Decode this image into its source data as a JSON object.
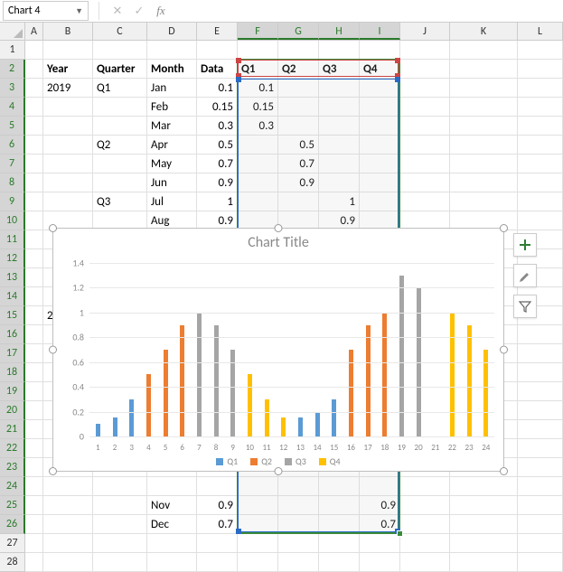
{
  "namebox": "Chart 4",
  "columns": [
    "A",
    "B",
    "C",
    "D",
    "E",
    "F",
    "G",
    "H",
    "I",
    "J",
    "K",
    "L"
  ],
  "col_widths": [
    "wA",
    "wB",
    "wC",
    "wD",
    "wE",
    "wF",
    "wG",
    "wH",
    "wI",
    "wJ",
    "wK",
    "wL"
  ],
  "selected_cols": [
    "F",
    "G",
    "H",
    "I"
  ],
  "row_count": 28,
  "selected_rows_from": 2,
  "selected_rows_to": 26,
  "headers": {
    "B": "Year",
    "C": "Quarter",
    "D": "Month",
    "E": "Data",
    "F": "Q1",
    "G": "Q2",
    "H": "Q3",
    "I": "Q4"
  },
  "table": [
    {
      "B": "2019",
      "C": "Q1",
      "D": "Jan",
      "E": "0.1",
      "F": "0.1"
    },
    {
      "C": "",
      "D": "Feb",
      "E": "0.15",
      "F": "0.15"
    },
    {
      "C": "",
      "D": "Mar",
      "E": "0.3",
      "F": "0.3"
    },
    {
      "C": "Q2",
      "D": "Apr",
      "E": "0.5",
      "G": "0.5"
    },
    {
      "C": "",
      "D": "May",
      "E": "0.7",
      "G": "0.7"
    },
    {
      "C": "",
      "D": "Jun",
      "E": "0.9",
      "G": "0.9"
    },
    {
      "C": "Q3",
      "D": "Jul",
      "E": "1",
      "H": "1"
    },
    {
      "C": "",
      "D": "Aug",
      "E": "0.9",
      "H": "0.9"
    },
    {
      "C": "",
      "D": "",
      "E": ""
    },
    {
      "C": "",
      "D": "",
      "E": ""
    },
    {
      "C": "",
      "D": "",
      "E": ""
    },
    {
      "C": "",
      "D": "",
      "E": ""
    },
    {
      "B": "202",
      "C": "",
      "D": "",
      "E": ""
    },
    {
      "C": "",
      "D": "",
      "E": ""
    },
    {
      "C": "",
      "D": "",
      "E": ""
    },
    {
      "C": "",
      "D": "",
      "E": ""
    },
    {
      "C": "",
      "D": "",
      "E": ""
    },
    {
      "C": "",
      "D": "",
      "E": ""
    },
    {
      "C": "",
      "D": "",
      "E": ""
    },
    {
      "C": "",
      "D": "",
      "E": ""
    },
    {
      "C": "",
      "D": "",
      "E": ""
    },
    {
      "C": "",
      "D": "",
      "E": ""
    },
    {
      "C": "",
      "D": "Nov",
      "E": "0.9",
      "I": "0.9"
    },
    {
      "C": "",
      "D": "Dec",
      "E": "0.7",
      "I": "0.7"
    }
  ],
  "chart_data": {
    "type": "bar",
    "title": "Chart Title",
    "xlabel": "",
    "ylabel": "",
    "ylim": [
      0,
      1.4
    ],
    "yticks": [
      0,
      0.2,
      0.4,
      0.6,
      0.8,
      1,
      1.2,
      1.4
    ],
    "categories": [
      1,
      2,
      3,
      4,
      5,
      6,
      7,
      8,
      9,
      10,
      11,
      12,
      13,
      14,
      15,
      16,
      17,
      18,
      19,
      20,
      21,
      22,
      23,
      24
    ],
    "series": [
      {
        "name": "Q1",
        "color": "#5b9bd5",
        "values": [
          0.1,
          0.15,
          0.3,
          null,
          null,
          null,
          null,
          null,
          null,
          null,
          null,
          null,
          0.15,
          0.2,
          0.3,
          null,
          null,
          null,
          null,
          null,
          null,
          null,
          null,
          null
        ]
      },
      {
        "name": "Q2",
        "color": "#ed7d31",
        "values": [
          null,
          null,
          null,
          0.5,
          0.7,
          0.9,
          null,
          null,
          null,
          null,
          null,
          null,
          null,
          null,
          null,
          0.7,
          0.9,
          1.0,
          null,
          null,
          null,
          null,
          null,
          null
        ]
      },
      {
        "name": "Q3",
        "color": "#a5a5a5",
        "values": [
          null,
          null,
          null,
          null,
          null,
          null,
          1.0,
          0.9,
          0.7,
          null,
          null,
          null,
          null,
          null,
          null,
          null,
          null,
          null,
          1.3,
          1.2,
          null,
          null,
          null,
          null
        ]
      },
      {
        "name": "Q4",
        "color": "#ffc000",
        "values": [
          null,
          null,
          null,
          null,
          null,
          null,
          null,
          null,
          null,
          0.5,
          0.3,
          0.15,
          null,
          null,
          null,
          null,
          null,
          null,
          null,
          null,
          null,
          1.0,
          0.9,
          0.7
        ]
      }
    ],
    "legend": [
      "Q1",
      "Q2",
      "Q3",
      "Q4"
    ]
  },
  "side_buttons": [
    "plus",
    "brush",
    "funnel"
  ]
}
